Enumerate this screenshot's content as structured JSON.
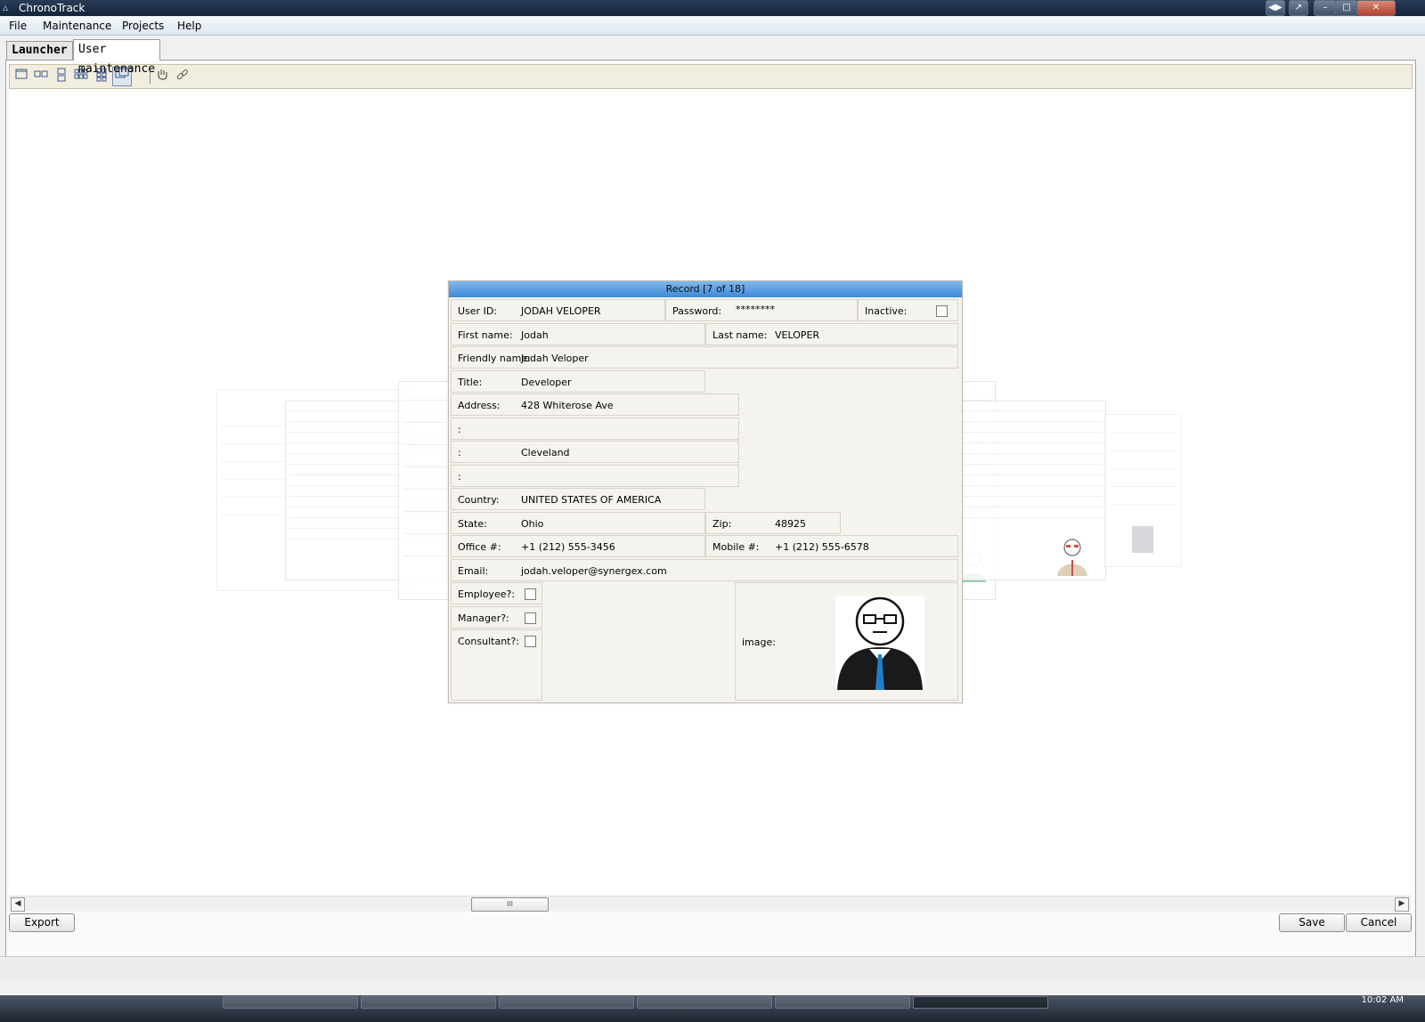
{
  "window": {
    "title": "ChronoTrack"
  },
  "menu": [
    "File",
    "Maintenance",
    "Projects",
    "Help"
  ],
  "tabs": [
    {
      "label": "Launcher",
      "active": false
    },
    {
      "label": "User maintenance",
      "active": true
    }
  ],
  "toolbar": {
    "icons": [
      "single-view-icon",
      "two-up-view-icon",
      "stacked-view-icon",
      "grid-view-icon",
      "tile-view-icon",
      "carousel-view-icon",
      "hand-pan-icon",
      "link-icon"
    ]
  },
  "record": {
    "header": "Record [7 of 18]",
    "user_id": {
      "label": "User ID:",
      "value": "JODAH VELOPER"
    },
    "password": {
      "label": "Password:",
      "value": "********"
    },
    "inactive": {
      "label": "Inactive:",
      "checked": false
    },
    "first_name": {
      "label": "First name:",
      "value": "Jodah"
    },
    "last_name": {
      "label": "Last name:",
      "value": "VELOPER"
    },
    "friendly_name": {
      "label": "Friendly name:",
      "value": "Jodah Veloper"
    },
    "title": {
      "label": "Title:",
      "value": "Developer"
    },
    "address": {
      "label": "Address:",
      "value": "428 Whiterose Ave"
    },
    "address2": {
      "label": ":",
      "value": ""
    },
    "city": {
      "label": ":",
      "value": "Cleveland"
    },
    "address4": {
      "label": ":",
      "value": ""
    },
    "country": {
      "label": "Country:",
      "value": "UNITED STATES OF AMERICA"
    },
    "state": {
      "label": "State:",
      "value": "Ohio"
    },
    "zip": {
      "label": "Zip:",
      "value": "48925"
    },
    "office": {
      "label": "Office #:",
      "value": "+1 (212) 555-3456"
    },
    "mobile": {
      "label": "Mobile #:",
      "value": "+1 (212) 555-6578"
    },
    "email": {
      "label": "Email:",
      "value": "jodah.veloper@synergex.com"
    },
    "employee": {
      "label": "Employee?:",
      "checked": false
    },
    "manager": {
      "label": "Manager?:",
      "checked": false
    },
    "consultant": {
      "label": "Consultant?:",
      "checked": false
    },
    "image": {
      "label": "image:",
      "icon": "developer-avatar-icon"
    }
  },
  "scrollbar": {
    "thumb_grip": "III",
    "position": 0.4
  },
  "buttons": {
    "export": "Export",
    "save": "Save",
    "cancel": "Cancel"
  },
  "taskbar": {
    "clock": "10:02 AM"
  },
  "colors": {
    "header_blue": "#3d89d6",
    "card_bg": "#f5f3ee",
    "tie_blue": "#1e7fc8"
  }
}
